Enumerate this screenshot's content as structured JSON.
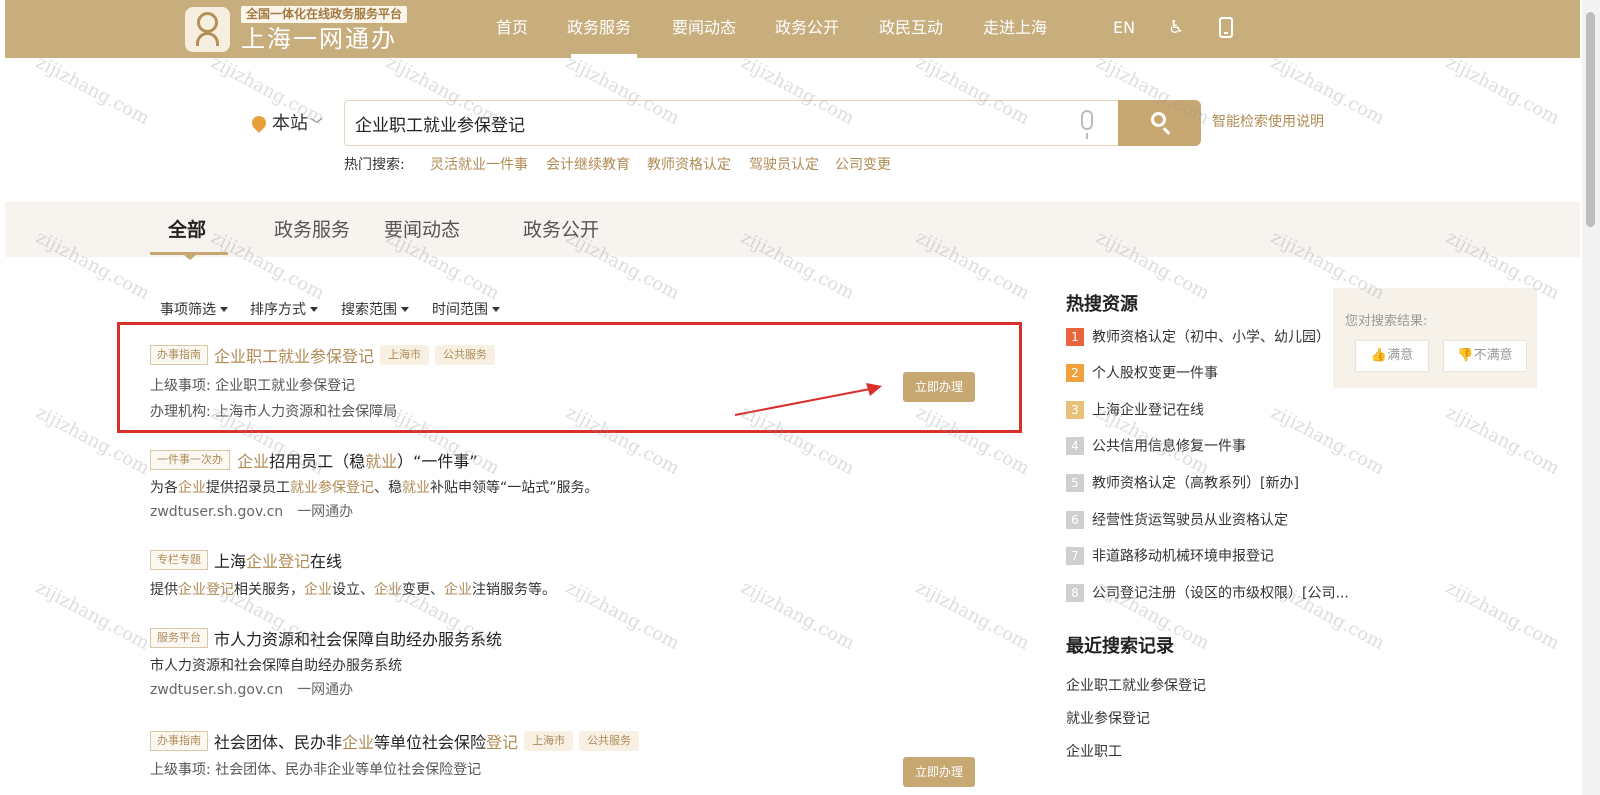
{
  "header": {
    "logo_sub": "全国一体化在线政务服务平台",
    "logo_main": "上海一网通办",
    "nav": [
      "首页",
      "政务服务",
      "要闻动态",
      "政务公开",
      "政民互动",
      "走进上海"
    ],
    "lang": "EN",
    "accessibility_icon": "♿"
  },
  "search": {
    "site_label": "本站",
    "query": "企业职工就业参保登记",
    "help": "智能检索使用说明",
    "hot_label": "热门搜索:",
    "hot_keywords": [
      "灵活就业一件事",
      "会计继续教育",
      "教师资格认定",
      "驾驶员认定",
      "公司变更"
    ]
  },
  "tabs": [
    "全部",
    "政务服务",
    "要闻动态",
    "政务公开"
  ],
  "filters": [
    "事项筛选",
    "排序方式",
    "搜索范围",
    "时间范围"
  ],
  "results": [
    {
      "tag": "办事指南",
      "title": "企业职工就业参保登记",
      "pills": [
        "上海市",
        "公共服务"
      ],
      "parent": "上级事项:  企业职工就业参保登记",
      "agency": "办理机构:  上海市人力资源和社会保障局",
      "button": "立即办理"
    },
    {
      "tag": "一件事一次办",
      "title_parts": [
        "企业",
        "招用员工（稳",
        "就业",
        "）“一件事”"
      ],
      "desc_parts": [
        "为各",
        "企业",
        "提供招录员工",
        "就业参保登记",
        "、稳",
        "就业",
        "补贴申领等“一站式”服务。"
      ],
      "url": "zwdtuser.sh.gov.cn",
      "source": "一网通办"
    },
    {
      "tag": "专栏专题",
      "title_parts": [
        "上海",
        "企业登记",
        "在线"
      ],
      "desc_parts": [
        "提供",
        "企业登记",
        "相关服务，",
        "企业",
        "设立、",
        "企业",
        "变更、",
        "企业",
        "注销服务等。"
      ]
    },
    {
      "tag": "服务平台",
      "title": "市人力资源和社会保障自助经办服务系统",
      "desc": "市人力资源和社会保障自助经办服务系统",
      "url": "zwdtuser.sh.gov.cn",
      "source": "一网通办"
    },
    {
      "tag": "办事指南",
      "title_parts": [
        "社会团体、民办非",
        "企业",
        "等单位社会保险",
        "登记"
      ],
      "pills": [
        "上海市",
        "公共服务"
      ],
      "parent": "上级事项:  社会团体、民办非企业等单位社会保险登记",
      "button": "立即办理"
    }
  ],
  "sidebar": {
    "hot_title": "热搜资源",
    "hot_items": [
      {
        "rank": "1",
        "text": "教师资格认定（初中、小学、幼儿园）",
        "color": "#e8643a"
      },
      {
        "rank": "2",
        "text": "个人股权变更一件事",
        "color": "#f0a03c"
      },
      {
        "rank": "3",
        "text": "上海企业登记在线",
        "color": "#e7c17a"
      },
      {
        "rank": "4",
        "text": "公共信用信息修复一件事",
        "color": "#cfcfcf"
      },
      {
        "rank": "5",
        "text": "教师资格认定（高教系列）[新办]",
        "color": "#cfcfcf"
      },
      {
        "rank": "6",
        "text": "经营性货运驾驶员从业资格认定",
        "color": "#cfcfcf"
      },
      {
        "rank": "7",
        "text": "非道路移动机械环境申报登记",
        "color": "#cfcfcf"
      },
      {
        "rank": "8",
        "text": "公司登记注册（设区的市级权限）[公司...",
        "color": "#cfcfcf"
      }
    ],
    "recent_title": "最近搜索记录",
    "recent_items": [
      "企业职工就业参保登记",
      "就业参保登记",
      "企业职工"
    ]
  },
  "feedback": {
    "title": "您对搜索结果:",
    "yes": "满意",
    "no": "不满意"
  },
  "watermark": "zijizhang.com",
  "colors": {
    "nav_bg": "#c8ad7d",
    "accent": "#c8a872",
    "highlight": "#b18b55",
    "annotation_red": "#d9302b"
  }
}
